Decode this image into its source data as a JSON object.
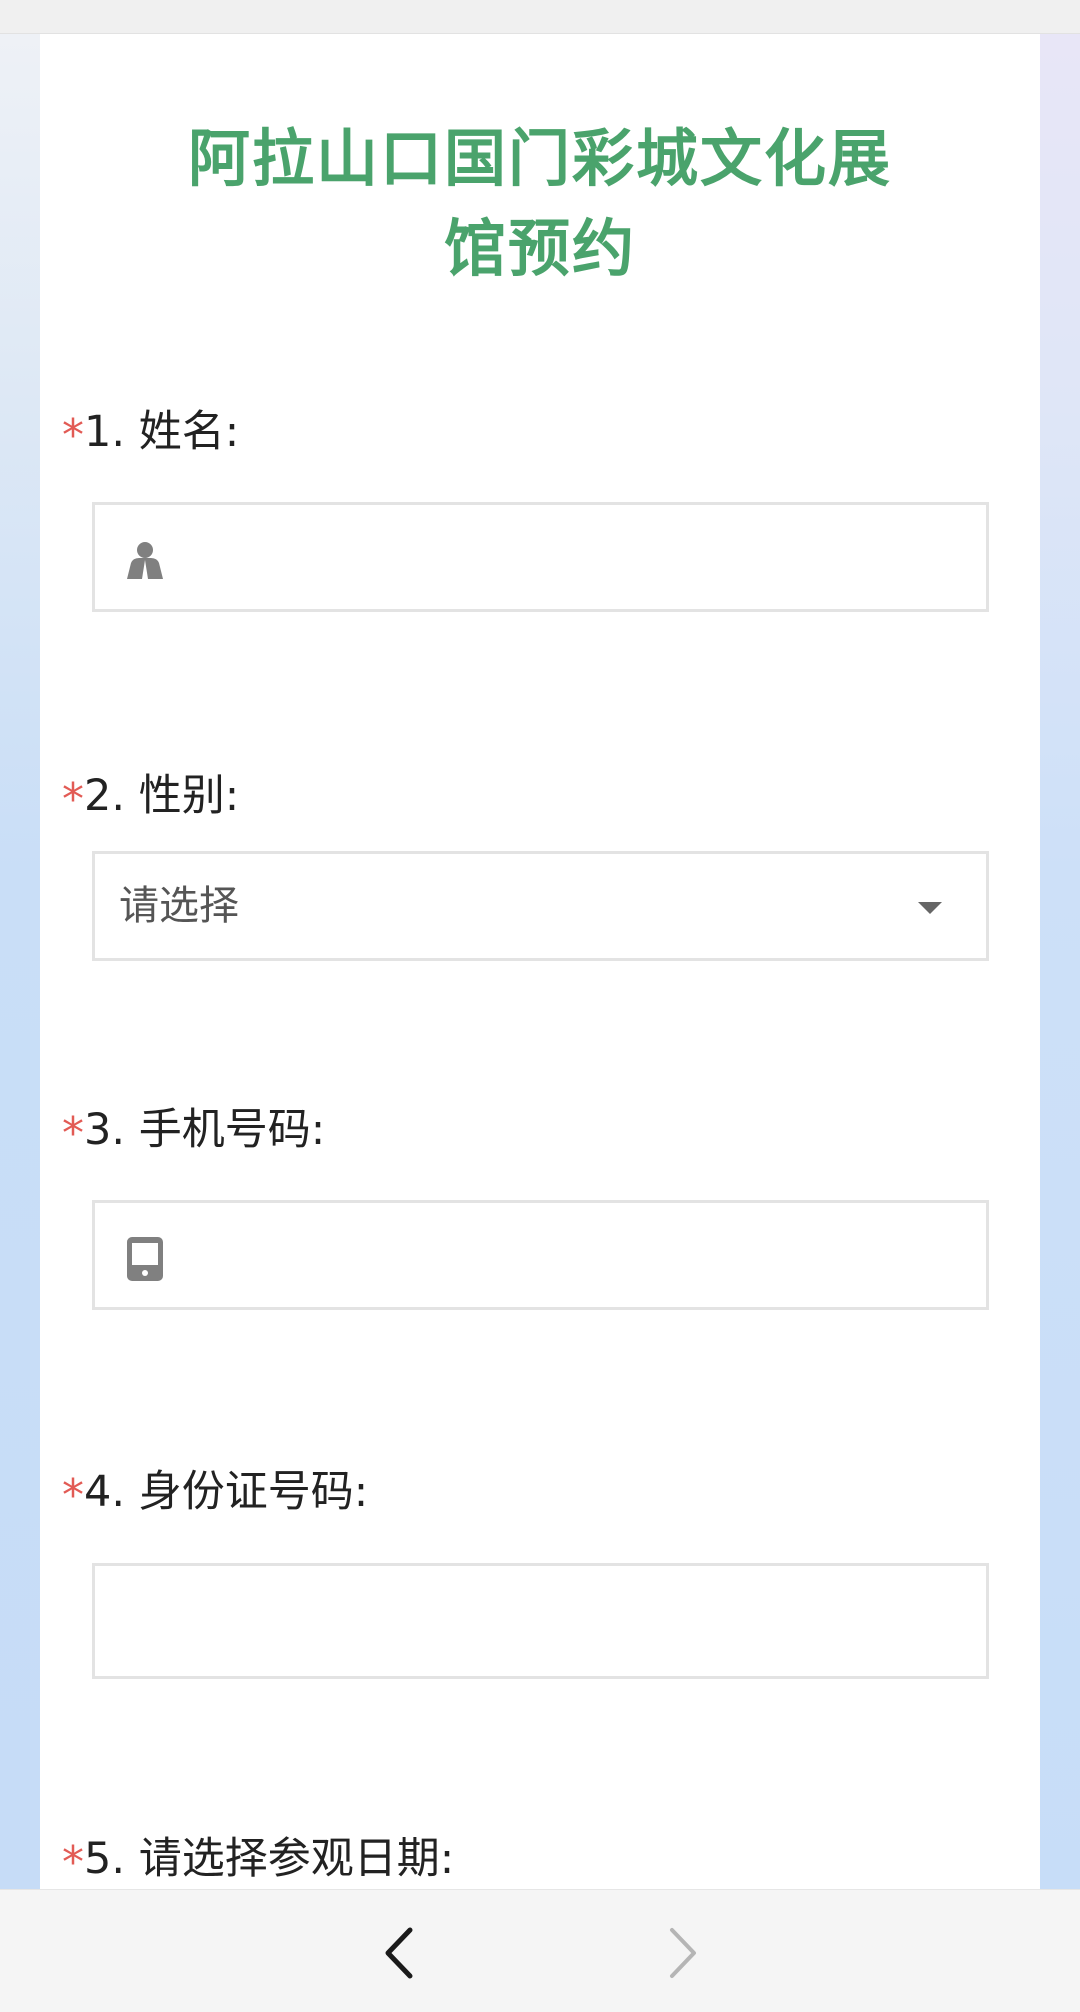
{
  "form": {
    "title_line1": "阿拉山口国门彩城文化展",
    "title_line2": "馆预约",
    "required_mark": "*",
    "questions": [
      {
        "label": "1. 姓名:",
        "type": "text",
        "icon": "person-icon",
        "value": "",
        "placeholder": ""
      },
      {
        "label": "2. 性别:",
        "type": "select",
        "selected": "请选择"
      },
      {
        "label": "3. 手机号码:",
        "type": "text",
        "icon": "phone-icon",
        "value": "",
        "placeholder": ""
      },
      {
        "label": "4. 身份证号码:",
        "type": "text",
        "value": "",
        "placeholder": ""
      },
      {
        "label": "5. 请选择参观日期:",
        "type": "date"
      }
    ]
  },
  "bottom_nav": {
    "back_icon": "chevron-left-icon",
    "forward_icon": "chevron-right-icon",
    "forward_enabled": false
  },
  "colors": {
    "title": "#4aa36c",
    "required": "#e25b55",
    "page_bg": "#c6dcf6"
  }
}
